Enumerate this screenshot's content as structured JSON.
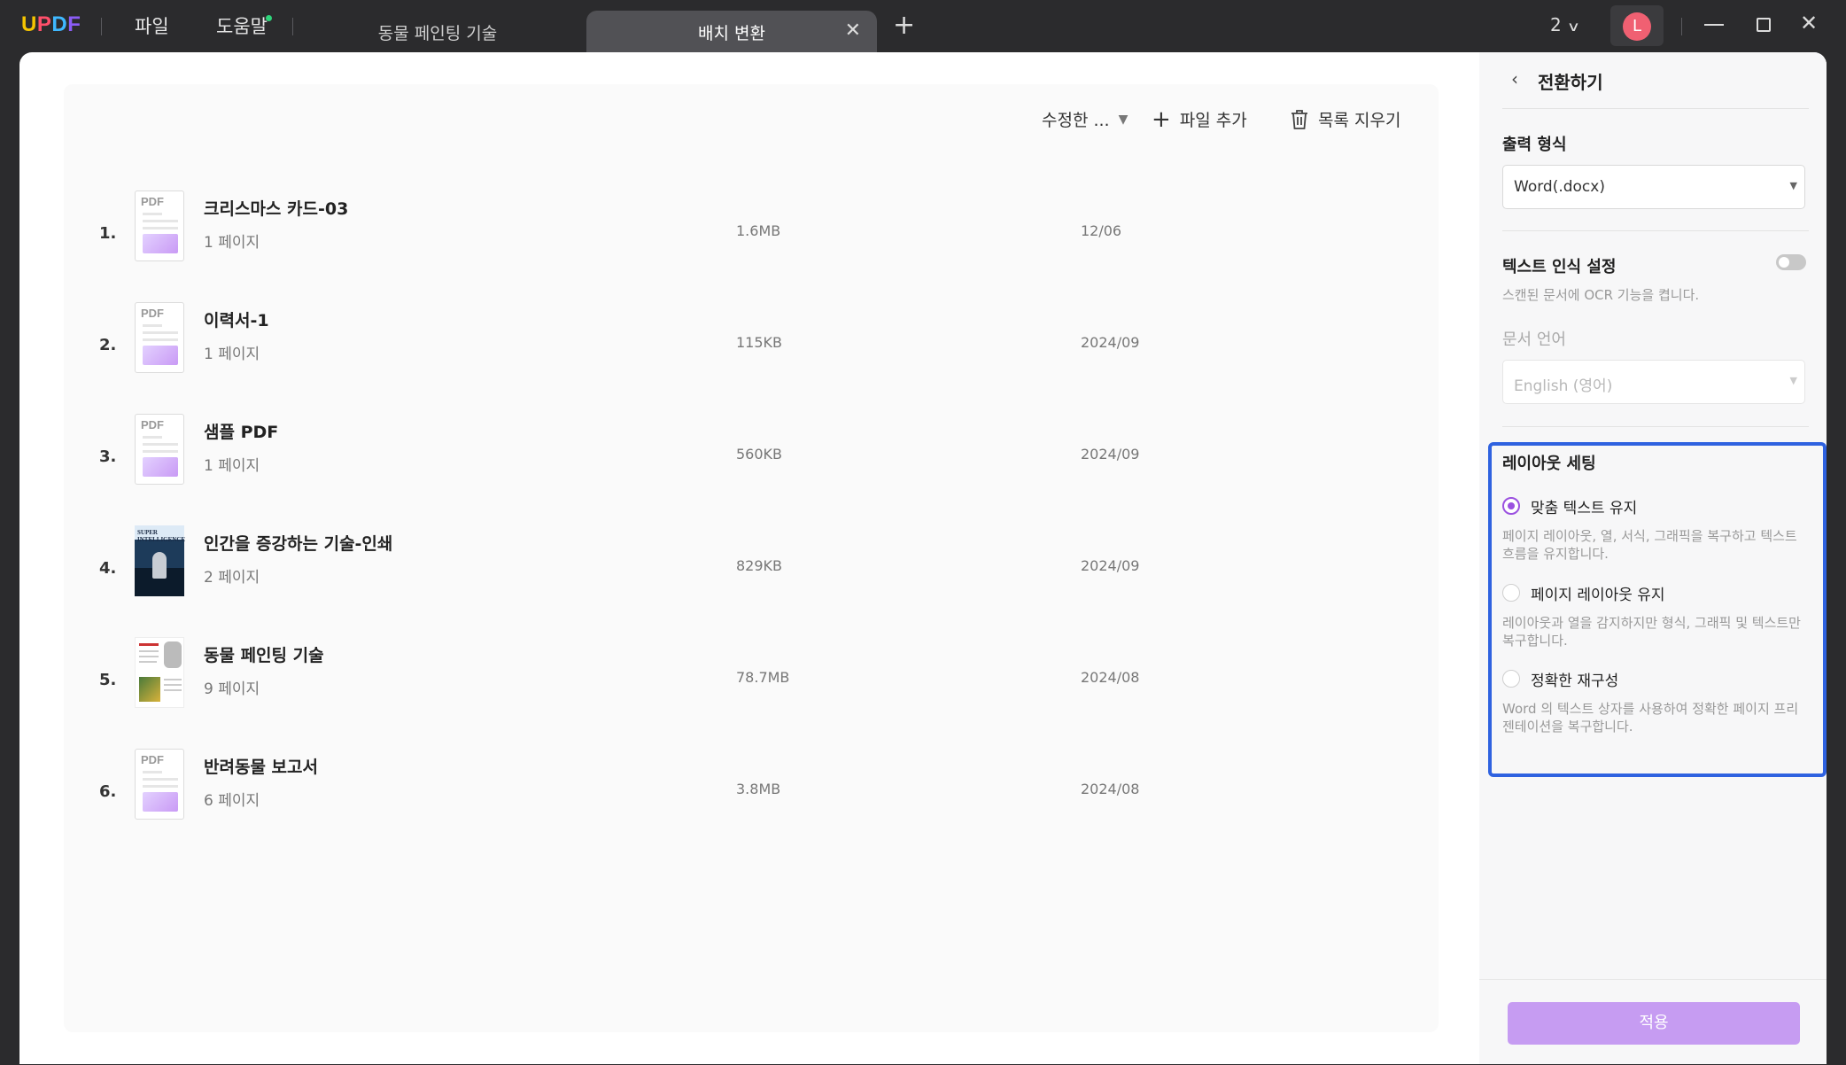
{
  "titlebar": {
    "logo": {
      "u": "U",
      "p": "P",
      "d": "D",
      "f": "F"
    },
    "menu": {
      "file": "파일",
      "help": "도움말"
    },
    "tabs": [
      {
        "label": "동물 페인팅 기술",
        "active": false
      },
      {
        "label": "배치 변환",
        "active": true
      }
    ],
    "page_count": "2",
    "avatar_letter": "L",
    "accent": "#9b51e0"
  },
  "toolbar": {
    "sort_label": "수정한 ...",
    "add_file_label": "파일 추가",
    "clear_list_label": "목록 지우기"
  },
  "files": [
    {
      "num": "1.",
      "name": "크리스마스 카드-03",
      "pages": "1 페이지",
      "size": "1.6MB",
      "date": "12/06",
      "thumb": "pdf"
    },
    {
      "num": "2.",
      "name": "이력서-1",
      "pages": "1 페이지",
      "size": "115KB",
      "date": "2024/09",
      "thumb": "pdf"
    },
    {
      "num": "3.",
      "name": "샘플 PDF",
      "pages": "1 페이지",
      "size": "560KB",
      "date": "2024/09",
      "thumb": "pdf"
    },
    {
      "num": "4.",
      "name": "인간을 증강하는 기술-인쇄",
      "pages": "2 페이지",
      "size": "829KB",
      "date": "2024/09",
      "thumb": "cover-book"
    },
    {
      "num": "5.",
      "name": "동물 페인팅 기술",
      "pages": "9 페이지",
      "size": "78.7MB",
      "date": "2024/08",
      "thumb": "cover-doc"
    },
    {
      "num": "6.",
      "name": "반려동물 보고서",
      "pages": "6 페이지",
      "size": "3.8MB",
      "date": "2024/08",
      "thumb": "pdf"
    }
  ],
  "thumb_label": "PDF",
  "book_cover_text": "SUPER\nINTELLIGENCE",
  "panel": {
    "back_title": "전환하기",
    "output_format_label": "출력 형식",
    "output_format_value": "Word(.docx)",
    "ocr_label": "텍스트 인식 설정",
    "ocr_desc": "스캔된 문서에 OCR 기능을 켭니다.",
    "ocr_enabled": false,
    "doc_lang_label": "문서 언어",
    "doc_lang_value": "English (영어)",
    "layout_title": "레이아웃 세팅",
    "options": [
      {
        "label": "맞춤 텍스트 유지",
        "desc": "페이지 레이아웃, 열, 서식, 그래픽을 복구하고 텍스트 흐름을 유지합니다.",
        "selected": true
      },
      {
        "label": "페이지 레이아웃 유지",
        "desc": "레이아웃과 열을 감지하지만 형식, 그래픽 및 텍스트만 복구합니다.",
        "selected": false
      },
      {
        "label": "정확한 재구성",
        "desc": "Word 의 텍스트 상자를 사용하여 정확한 페이지 프리젠테이션을 복구합니다.",
        "selected": false
      }
    ],
    "apply_label": "적용"
  }
}
